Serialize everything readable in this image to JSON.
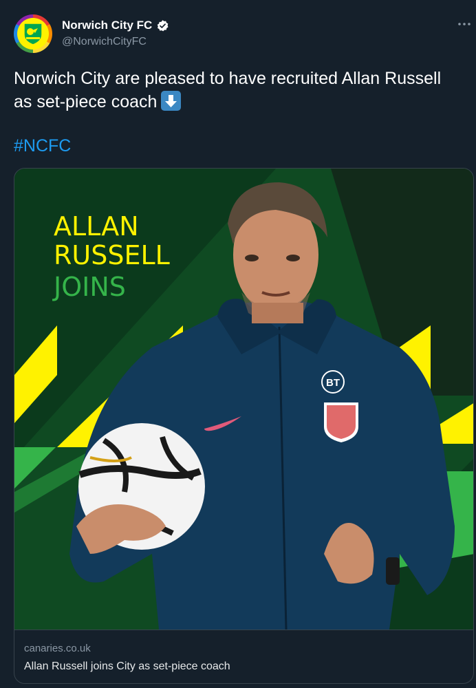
{
  "account": {
    "display_name": "Norwich City FC",
    "handle": "@NorwichCityFC",
    "verified": true
  },
  "tweet": {
    "text": "Norwich City are pleased to have recruited Allan Russell as set-piece coach",
    "emoji": "down-arrow-emoji",
    "hashtag": "#NCFC"
  },
  "card": {
    "image_lines": [
      "ALLAN",
      "RUSSELL",
      "JOINS"
    ],
    "badge_text": "BT",
    "domain": "canaries.co.uk",
    "title": "Allan Russell joins City as set-piece coach"
  },
  "colors": {
    "background": "#15202b",
    "hashtag": "#1d9bf0",
    "brand_yellow": "#fff200",
    "brand_green": "#35b44a",
    "dark_green": "#0b3a1c"
  },
  "icons": {
    "more": "more-horizontal-icon",
    "verified": "verified-badge-icon"
  }
}
